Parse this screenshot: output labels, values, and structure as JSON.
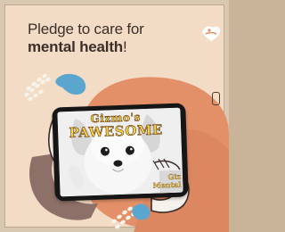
{
  "headline": {
    "line1": "Pledge to care for",
    "line2_bold": "mental health",
    "line2_suffix": "!"
  },
  "video": {
    "brand_line1": "Gizmo's",
    "brand_line2": "PAWESOME",
    "overlay_line1": "Giz",
    "overlay_line2": "Mental"
  },
  "icons": {
    "logo": "hands-heart-logo",
    "side_device": "phone-outline-icon"
  },
  "colors": {
    "background": "#f3dcc5",
    "blob": "#e39068",
    "accent_blue": "#5aa6cf",
    "phone_frame": "#161616",
    "text": "#3c2f2a"
  }
}
